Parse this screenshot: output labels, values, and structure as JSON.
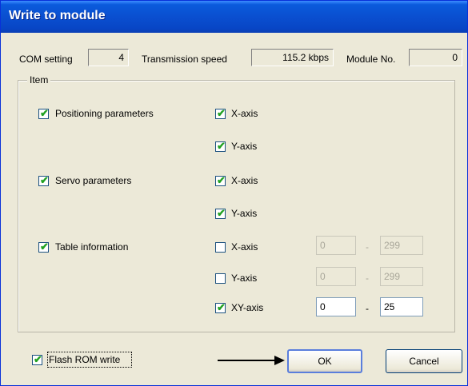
{
  "title": "Write to module",
  "com_setting": {
    "label": "COM setting",
    "value": "4"
  },
  "transmission_speed": {
    "label": "Transmission speed",
    "value": "115.2 kbps"
  },
  "module_no": {
    "label": "Module No.",
    "value": "0"
  },
  "group_label": "Item",
  "items": {
    "positioning": {
      "label": "Positioning parameters",
      "checked": true,
      "x_axis": "X-axis",
      "y_axis": "Y-axis"
    },
    "servo": {
      "label": "Servo parameters",
      "checked": true,
      "x_axis": "X-axis",
      "y_axis": "Y-axis"
    },
    "table": {
      "label": "Table information",
      "checked": true,
      "x_axis": {
        "label": "X-axis",
        "checked": false,
        "from": "0",
        "to": "299"
      },
      "y_axis": {
        "label": "Y-axis",
        "checked": false,
        "from": "0",
        "to": "299"
      },
      "xy_axis": {
        "label": "XY-axis",
        "checked": true,
        "from": "0",
        "to": "25"
      }
    }
  },
  "range_separator": "-",
  "flash_rom": {
    "label": "Flash ROM write",
    "checked": true
  },
  "ok_label": "OK",
  "cancel_label": "Cancel",
  "check_mark": "✔"
}
